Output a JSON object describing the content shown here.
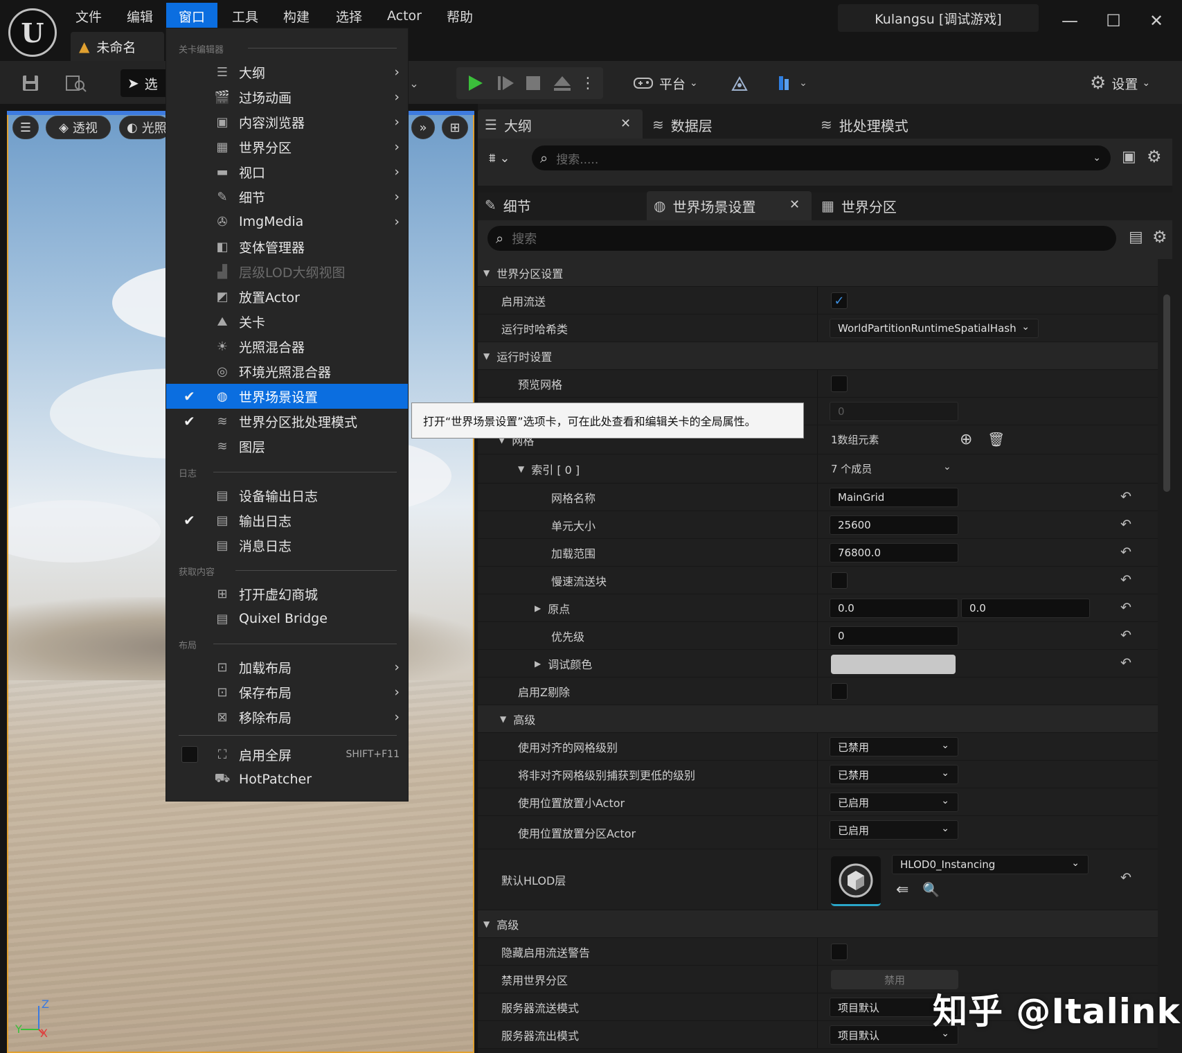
{
  "app": {
    "logo": "U",
    "project_tab": "未命名",
    "window_title": "Kulangsu [调试游戏]"
  },
  "menubar": [
    "文件",
    "编辑",
    "窗口",
    "工具",
    "构建",
    "选择",
    "Actor",
    "帮助"
  ],
  "toolbar": {
    "select_label": "选",
    "platform_label": "平台",
    "settings_label": "设置"
  },
  "viewport": {
    "perspective_label": "透视",
    "lighting_label": "光照",
    "axis_z": "Z",
    "axis_y": "Y",
    "axis_x": "X"
  },
  "panel_tabs_top": [
    "大纲",
    "数据层",
    "批处理模式"
  ],
  "outliner_search_placeholder": "搜索.....",
  "panel_tabs_detail": [
    "细节",
    "世界场景设置",
    "世界分区"
  ],
  "details_search_placeholder": "搜索",
  "window_menu": {
    "sections": {
      "level_editor": "关卡编辑器",
      "log": "日志",
      "get_content": "获取内容",
      "layout": "布局"
    },
    "items": [
      {
        "label": "大纲",
        "arrow": true
      },
      {
        "label": "过场动画",
        "arrow": true
      },
      {
        "label": "内容浏览器",
        "arrow": true
      },
      {
        "label": "世界分区",
        "arrow": true
      },
      {
        "label": "视口",
        "arrow": true
      },
      {
        "label": "细节",
        "arrow": true
      },
      {
        "label": "ImgMedia",
        "arrow": true
      },
      {
        "label": "变体管理器"
      },
      {
        "label": "层级LOD大纲视图",
        "disabled": true
      },
      {
        "label": "放置Actor"
      },
      {
        "label": "关卡"
      },
      {
        "label": "光照混合器"
      },
      {
        "label": "环境光照混合器"
      },
      {
        "label": "世界场景设置",
        "checked": true,
        "highlighted": true
      },
      {
        "label": "世界分区批处理模式",
        "checked": true
      },
      {
        "label": "图层"
      },
      {
        "label": "设备输出日志"
      },
      {
        "label": "输出日志",
        "checked": true
      },
      {
        "label": "消息日志"
      },
      {
        "label": "打开虚幻商城"
      },
      {
        "label": "Quixel Bridge"
      },
      {
        "label": "加载布局",
        "arrow": true
      },
      {
        "label": "保存布局",
        "arrow": true
      },
      {
        "label": "移除布局",
        "arrow": true
      },
      {
        "label": "启用全屏",
        "shortcut": "SHIFT+F11"
      },
      {
        "label": "HotPatcher"
      }
    ]
  },
  "tooltip": "打开“世界场景设置”选项卡，可在此处查看和编辑关卡的全局属性。",
  "details": {
    "cat_world_partition": "世界分区设置",
    "enable_streaming": "启用流送",
    "runtime_hash_class": "运行时哈希类",
    "runtime_hash_value": "WorldPartitionRuntimeSpatialHash",
    "cat_runtime": "运行时设置",
    "preview_grids": "预览网格",
    "preview_level_value": "0",
    "grids": "网格",
    "grids_count": "1数组元素",
    "index0": "索引 [ 0 ]",
    "index0_members": "7 个成员",
    "grid_name": "网格名称",
    "grid_name_value": "MainGrid",
    "cell_size": "单元大小",
    "cell_size_value": "25600",
    "loading_range": "加载范围",
    "loading_range_value": "76800.0",
    "block_slow_streaming": "慢速流送块",
    "origin": "原点",
    "origin_x": "0.0",
    "origin_y": "0.0",
    "priority": "优先级",
    "priority_value": "0",
    "debug_color": "调试颜色",
    "enable_z_culling": "启用Z剔除",
    "cat_advanced": "高级",
    "use_aligned_grid_levels": "使用对齐的网格级别",
    "use_aligned_grid_levels_value": "已禁用",
    "snap_nonaligned": "将非对齐网格级别捕获到更低的级别",
    "snap_nonaligned_value": "已禁用",
    "place_small_actors": "使用位置放置小Actor",
    "place_small_actors_value": "已启用",
    "place_partitioned_actors": "使用位置放置分区Actor",
    "place_partitioned_actors_value": "已启用",
    "default_hlod_layer": "默认HLOD层",
    "default_hlod_layer_value": "HLOD0_Instancing",
    "cat_advanced2": "高级",
    "hide_streaming_warning": "隐藏启用流送警告",
    "disable_world_partition": "禁用世界分区",
    "disable_button": "禁用",
    "server_streaming_mode": "服务器流送模式",
    "server_streaming_mode_value": "项目默认",
    "server_streaming_out_mode": "服务器流出模式",
    "server_streaming_out_mode_value": "项目默认"
  },
  "watermark": "知乎 @Italink",
  "colors": {
    "accent": "#0b6ee0",
    "checkbox_blue": "#3d8fe0",
    "play_green": "#3bbf3b"
  }
}
